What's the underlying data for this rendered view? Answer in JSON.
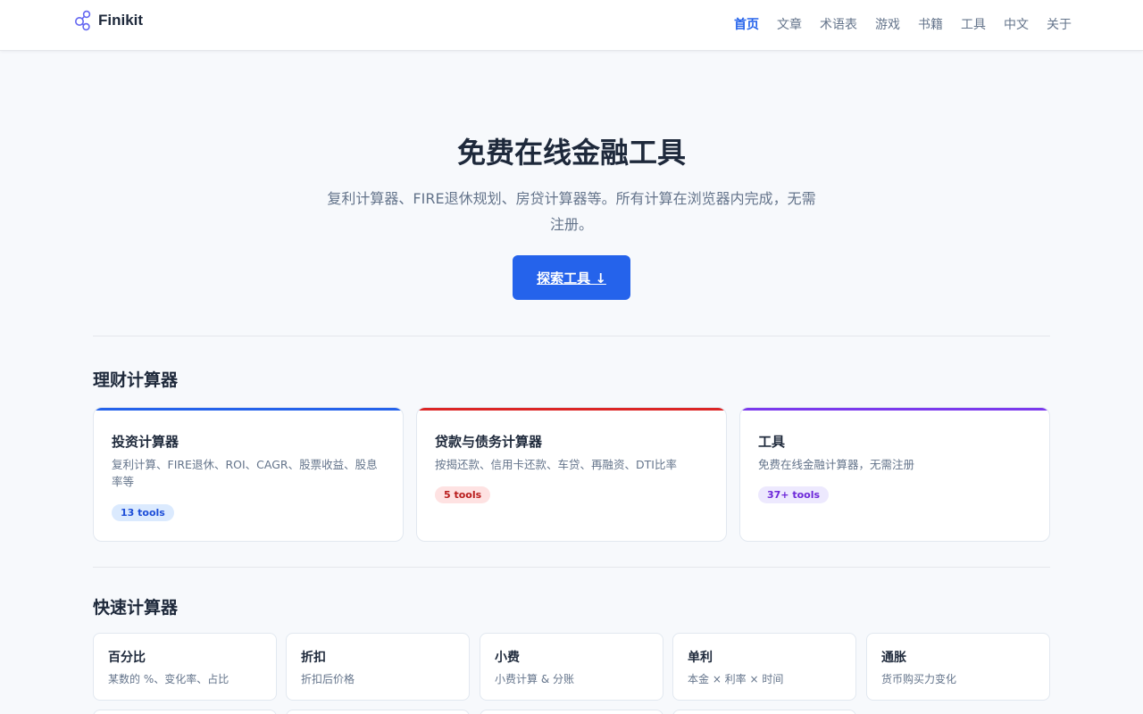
{
  "header": {
    "logo_text": "Finikit",
    "logo_icon": "molecule-icon",
    "nav": [
      {
        "label": "首页",
        "active": true
      },
      {
        "label": "文章"
      },
      {
        "label": "术语表"
      },
      {
        "label": "游戏"
      },
      {
        "label": "书籍"
      },
      {
        "label": "工具"
      },
      {
        "label": "中文"
      },
      {
        "label": "关于"
      }
    ]
  },
  "hero": {
    "title": "免费在线金融工具",
    "subtitle": "复利计算器、FIRE退休规划、房贷计算器等。所有计算在浏览器内完成，无需注册。",
    "button_label": "探索工具 ↓"
  },
  "finance_section": {
    "title": "理财计算器",
    "cards": [
      {
        "title": "投资计算器",
        "desc": "复利计算、FIRE退休、ROI、CAGR、股票收益、股息率等",
        "badge": "13 tools",
        "accent": "#2563eb",
        "badge_bg": "#dbeafe",
        "badge_fg": "#1d4ed8"
      },
      {
        "title": "贷款与债务计算器",
        "desc": "按揭还款、信用卡还款、车贷、再融资、DTI比率",
        "badge": "5 tools",
        "accent": "#dc2626",
        "badge_bg": "#fee2e2",
        "badge_fg": "#b91c1c"
      },
      {
        "title": "工具",
        "desc": "免费在线金融计算器，无需注册",
        "badge": "37+ tools",
        "accent": "#7c3aed",
        "badge_bg": "#ede9fe",
        "badge_fg": "#6d28d9"
      }
    ]
  },
  "quick_section": {
    "title": "快速计算器",
    "cards": [
      {
        "title": "百分比",
        "desc": "某数的 %、变化率、占比"
      },
      {
        "title": "折扣",
        "desc": "折扣后价格"
      },
      {
        "title": "小费",
        "desc": "小费计算 & 分账"
      },
      {
        "title": "单利",
        "desc": "本金 × 利率 × 时间"
      },
      {
        "title": "通胀",
        "desc": "货币购买力变化"
      }
    ]
  }
}
